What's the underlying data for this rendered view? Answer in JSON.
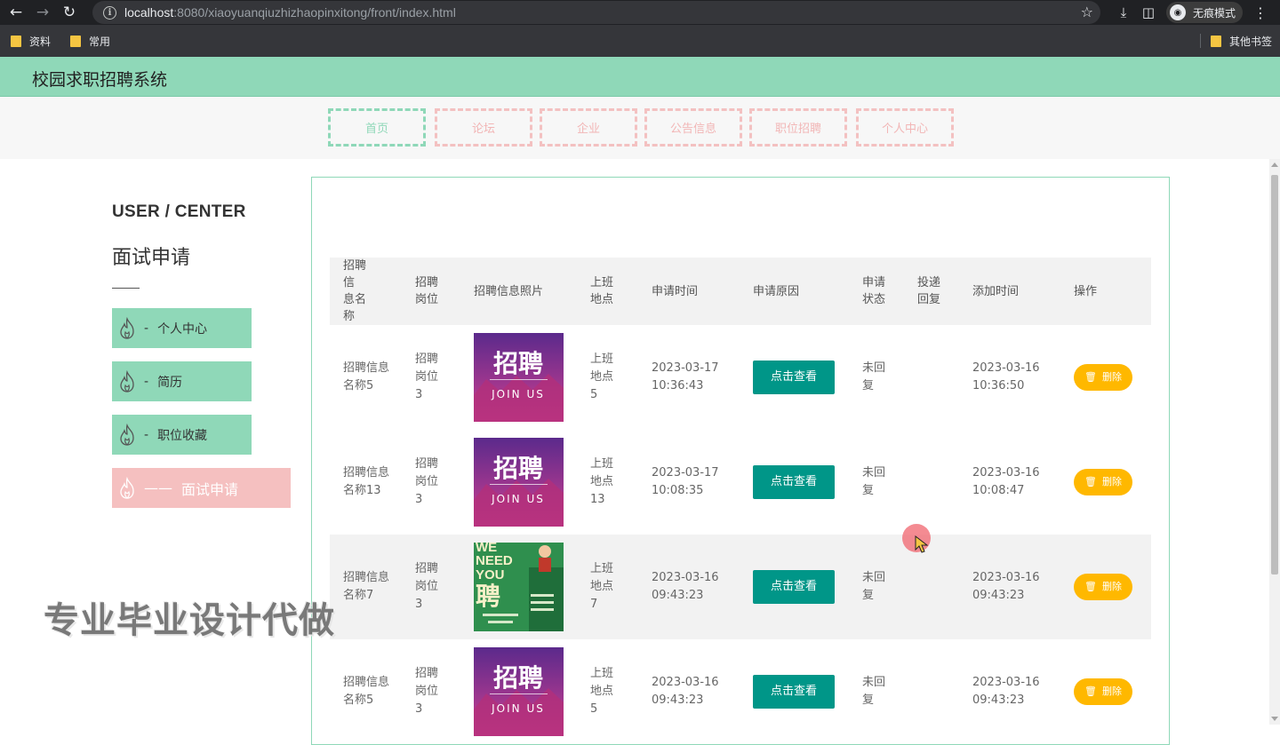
{
  "browser": {
    "url_host": "localhost",
    "url_rest": ":8080/xiaoyuanqiuzhizhaopinxitong/front/index.html",
    "incognito_label": "无痕模式",
    "bookmarks": [
      "资料",
      "常用"
    ],
    "other_bookmarks": "其他书签"
  },
  "site": {
    "title": "校园求职招聘系统"
  },
  "nav": [
    "首页",
    "论坛",
    "企业",
    "公告信息",
    "职位招聘",
    "个人中心"
  ],
  "sidebar": {
    "heading": "USER / CENTER",
    "sub": "面试申请",
    "items": [
      {
        "dash": "-",
        "label": "个人中心"
      },
      {
        "dash": "-",
        "label": "简历"
      },
      {
        "dash": "-",
        "label": "职位收藏"
      },
      {
        "dash": "——",
        "label": "面试申请"
      }
    ]
  },
  "watermark": "专业毕业设计代做",
  "table": {
    "headers": {
      "name_a": "招聘信",
      "name_b": "息名称",
      "post_a": "招聘",
      "post_b": "岗位",
      "photo": "招聘信息照片",
      "loc_a": "上班",
      "loc_b": "地点",
      "apply_time": "申请时间",
      "reason": "申请原因",
      "status_a": "申请",
      "status_b": "状态",
      "reply_a": "投递",
      "reply_b": "回复",
      "added": "添加时间",
      "ops": "操作"
    },
    "view_label": "点击查看",
    "delete_label": "删除",
    "rows": [
      {
        "name": "招聘信息名称5",
        "post": "招聘岗位3",
        "loc": "上班地点5",
        "apply_date": "2023-03-17",
        "apply_clock": "10:36:43",
        "status": "未回复",
        "add_date": "2023-03-16",
        "add_clock": "10:36:50"
      },
      {
        "name": "招聘信息名称13",
        "post": "招聘岗位3",
        "loc": "上班地点13",
        "apply_date": "2023-03-17",
        "apply_clock": "10:08:35",
        "status": "未回复",
        "add_date": "2023-03-16",
        "add_clock": "10:08:47"
      },
      {
        "name": "招聘信息名称7",
        "post": "招聘岗位3",
        "loc": "上班地点7",
        "apply_date": "2023-03-16",
        "apply_clock": "09:43:23",
        "status": "未回复",
        "add_date": "2023-03-16",
        "add_clock": "09:43:23"
      },
      {
        "name": "招聘信息名称5",
        "post": "招聘岗位3",
        "loc": "上班地点5",
        "apply_date": "2023-03-16",
        "apply_clock": "09:43:23",
        "status": "未回复",
        "add_date": "2023-03-16",
        "add_clock": "09:43:23"
      }
    ],
    "poster_purple": {
      "big": "招聘",
      "small": "JOIN US"
    },
    "poster_green": {
      "line1": "WE",
      "line2": "NEED",
      "line3": "YOU",
      "big": "聘"
    }
  },
  "colors": {
    "accent_green": "#8fd8b8",
    "accent_pink": "#f5c0c0",
    "teal_button": "#009688",
    "amber_button": "#ffb800"
  }
}
